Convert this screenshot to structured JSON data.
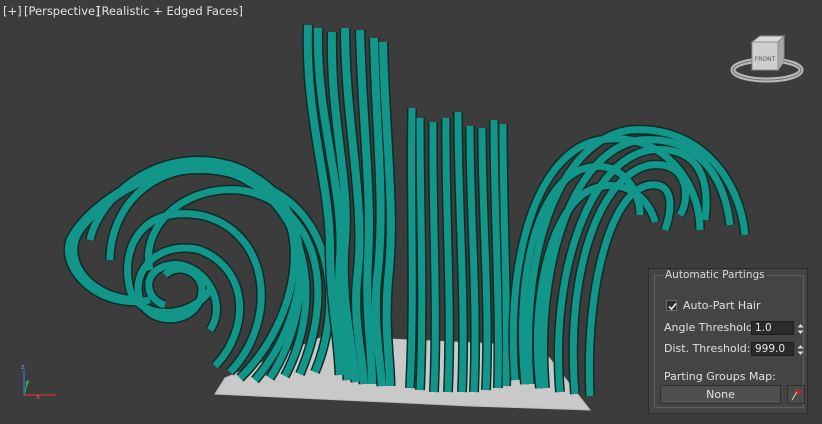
{
  "viewport": {
    "label_plus": "[+]",
    "label_view": "[Perspective]",
    "label_shading": "[Realistic + Edged Faces]",
    "viewcube_face": "FRONT",
    "axis_labels": {
      "x": "x",
      "y": "y",
      "z": "z"
    },
    "colors": {
      "background": "#3c3c3c",
      "hair": "#13968a",
      "hair_edge": "#0a2a26",
      "ground": "#c8c8c8"
    }
  },
  "panel": {
    "title": "Automatic Partings",
    "auto_part_hair": {
      "label": "Auto-Part Hair",
      "checked": true
    },
    "angle_threshold": {
      "label": "Angle Threshold:",
      "value": "1.0"
    },
    "dist_threshold": {
      "label": "Dist. Threshold:",
      "value": "999.0"
    },
    "parting_groups_map": {
      "label": "Parting Groups Map:",
      "value": "None"
    },
    "icons": {
      "pick": "red-flag-icon",
      "spinner": "spinner-arrows-icon"
    }
  }
}
